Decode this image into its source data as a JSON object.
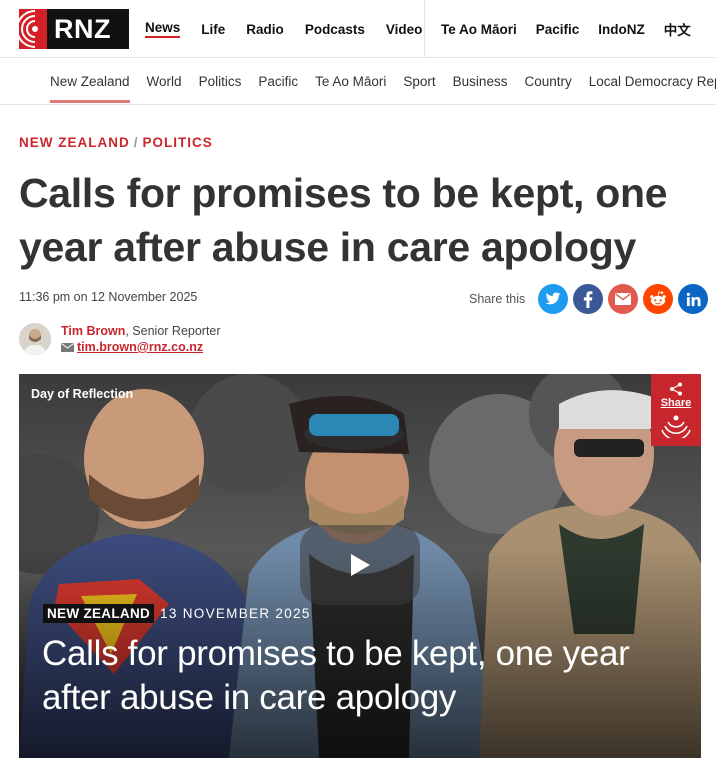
{
  "brand": {
    "logo_text": "RNZ"
  },
  "main_nav": [
    {
      "label": "News",
      "active": true
    },
    {
      "label": "Life"
    },
    {
      "label": "Radio"
    },
    {
      "label": "Podcasts"
    },
    {
      "label": "Video"
    }
  ],
  "secondary_nav": [
    {
      "label": "Te Ao Māori"
    },
    {
      "label": "Pacific"
    },
    {
      "label": "IndoNZ"
    },
    {
      "label": "中文"
    }
  ],
  "sub_nav": [
    {
      "label": "New Zealand",
      "active": true
    },
    {
      "label": "World"
    },
    {
      "label": "Politics"
    },
    {
      "label": "Pacific"
    },
    {
      "label": "Te Ao Māori"
    },
    {
      "label": "Sport"
    },
    {
      "label": "Business"
    },
    {
      "label": "Country"
    },
    {
      "label": "Local Democracy Rep"
    }
  ],
  "article": {
    "kicker_section": "NEW ZEALAND",
    "kicker_separator": "/",
    "kicker_subsection": "POLITICS",
    "headline": "Calls for promises to be kept, one year after abuse in care apology",
    "dateline": "11:36 pm on 12 November 2025",
    "share_label": "Share this",
    "author_name": "Tim Brown",
    "author_role": ", Senior Reporter",
    "author_email": "tim.brown@rnz.co.nz"
  },
  "share_icons": [
    "twitter-icon",
    "facebook-icon",
    "email-icon",
    "reddit-icon",
    "linkedin-icon"
  ],
  "hero": {
    "tag": "Day of Reflection",
    "share_label": "Share",
    "overlay_badge": "NEW ZEALAND",
    "overlay_date": "13 NOVEMBER 2025",
    "overlay_title": "Calls for promises to be kept, one year after abuse in care apology"
  },
  "colors": {
    "brand_red": "#d32027",
    "kicker_red": "#c8262d",
    "twitter": "#1d9bf0",
    "facebook": "#3b5998",
    "email": "#e05a4f",
    "reddit": "#ff4500",
    "linkedin": "#0a66c2"
  }
}
